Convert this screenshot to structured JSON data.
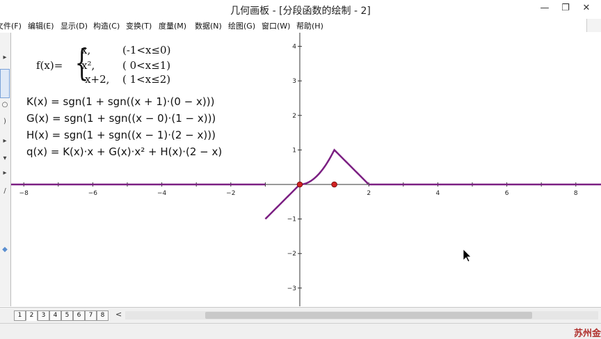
{
  "window": {
    "title": "几何画板 - [分段函数的绘制 - 2]",
    "minimize_glyph": "—",
    "restore_glyph": "❐",
    "close_glyph": "✕"
  },
  "menu": [
    "文件(F)",
    "编辑(E)",
    "显示(D)",
    "构造(C)",
    "变换(T)",
    "度量(M)",
    "数据(N)",
    "绘图(G)",
    "窗口(W)",
    "帮助(H)"
  ],
  "canvas": {
    "piecewise": {
      "lhs": "f(x)=",
      "brace": "{",
      "rows": [
        {
          "expr": "x,",
          "cond": "(-1<x≤0)"
        },
        {
          "expr": "x²,",
          "cond": "( 0<x≤1)"
        },
        {
          "expr": "-x+2,",
          "cond": "( 1<x≤2)"
        }
      ]
    },
    "formulas": [
      "K(x) = sgn(1 + sgn((x + 1)·(0 − x)))",
      "G(x) = sgn(1 + sgn((x − 0)·(1 − x)))",
      "H(x) = sgn(1 + sgn((x − 1)·(2 − x)))",
      "q(x) = K(x)·x + G(x)·x² + H(x)·(2 − x)"
    ],
    "axes": {
      "x_ticks": [
        "−8",
        "−6",
        "−4",
        "−2",
        "2",
        "4",
        "6",
        "8"
      ],
      "y_ticks": [
        "4",
        "3",
        "2",
        "1",
        "−1",
        "−2",
        "−3"
      ],
      "curve_color": "#7b1f82",
      "point_color": "#d22222"
    }
  },
  "bottom": {
    "pages": [
      "1",
      "2",
      "3",
      "4",
      "5",
      "6",
      "7",
      "8"
    ],
    "scroll_left": "<"
  },
  "status": {
    "watermark": "苏州金"
  }
}
